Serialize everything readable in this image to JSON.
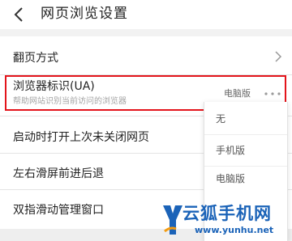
{
  "header": {
    "title": "网页浏览设置"
  },
  "rows": {
    "page_turn": {
      "label": "翻页方式"
    },
    "ua": {
      "title": "浏览器标识(UA)",
      "subtitle": "帮助网站识别当前访问的浏览器",
      "value": "电脑版"
    },
    "restore": {
      "label": "启动时打开上次未关闭网页"
    },
    "swipe": {
      "label": "左右滑屏前进后退"
    },
    "two_finger": {
      "label": "双指滑动管理窗口"
    }
  },
  "dropdown": {
    "options": [
      "无",
      "手机版",
      "电脑版"
    ],
    "selected": "电脑版"
  },
  "watermark": {
    "brand": "云狐手机网",
    "url": "www.yunhu.net",
    "logo_letter": "Y"
  },
  "colors": {
    "highlight": "#e3141b",
    "watermark": "#1b63b8",
    "watermark_accent": "#f39c12"
  }
}
